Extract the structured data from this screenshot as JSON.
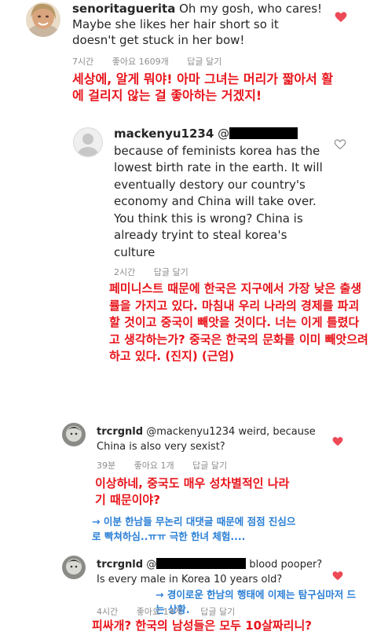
{
  "comments": [
    {
      "username": "senoritaguerita",
      "text": "Oh my gosh, who cares! Maybe she likes her hair short so it doesn't get stuck in her bow!",
      "time": "7시간",
      "likes": "좋아요 1609개",
      "reply": "답글 달기",
      "liked": true,
      "translation": "세상에, 알게 뭐야! 아마 그녀는 머리가 짧아서 활에 걸리지 않는 걸 좋아하는 거겠지!"
    },
    {
      "username": "mackenyu1234",
      "mention": "@",
      "text": "because of feminists korea has the lowest birth rate in the earth. It will eventually destory our country's economy and China will take over. You think this is wrong? China is already tryint to steal korea's culture",
      "time": "2시간",
      "reply": "답글 달기",
      "liked": false,
      "translation": "페미니스트 때문에 한국은 지구에서 가장 낮은 출생률을 가지고 있다. 마침내 우리 나라의 경제를 파괴할 것이고 중국이 빼앗을 것이다. 너는 이게 틀렸다고 생각하는가? 중국은 한국의 문화를 이미 빼앗으려 하고 있다.",
      "translation_tag": "(진지) (근엄)"
    },
    {
      "username": "trcrgnld",
      "mention": "@mackenyu1234",
      "text": "weird, because China is also very sexist?",
      "time": "39분",
      "likes": "좋아요 1개",
      "reply": "답글 달기",
      "liked": true,
      "translation": "이상하네, 중국도 매우 성차별적인 나라기 때문이야?",
      "note": "→ 이분 한남들 무논리 대댓글 때문에 점점 진심으로 빡쳐하심..ㅠㅠ 극한 한녀 체험...."
    },
    {
      "username": "trcrgnld",
      "mention": "@",
      "text_after_mention": "blood",
      "text": "pooper? Is every male in Korea 10 years old?",
      "time": "4시간",
      "likes": "좋아요 14개",
      "reply": "답글 달기",
      "liked": true,
      "note": "→ 경이로운 한남의 행태에 이제는 탐구심마저 드는 상황.",
      "translation": "피싸개? 한국의 남성들은 모두 10살짜리니?"
    }
  ],
  "colors": {
    "translation": "#e8141b",
    "note": "#2a7fd6",
    "heart": "#ed4956"
  }
}
